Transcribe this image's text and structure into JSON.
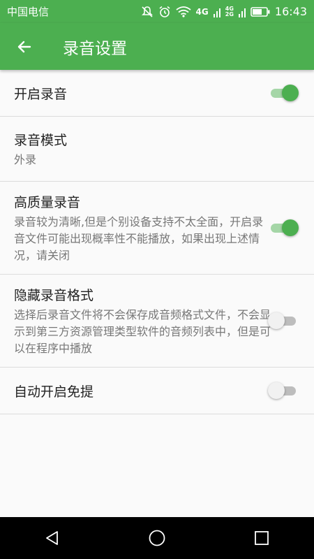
{
  "status_bar": {
    "carrier": "中国电信",
    "network_4g": "4G",
    "network_small_top": "4G",
    "network_small_bottom": "2G",
    "time": "16:43",
    "icons": [
      "mute-icon",
      "alarm-icon",
      "wifi-icon",
      "signal-icon",
      "battery-icon"
    ]
  },
  "app_bar": {
    "title": "录音设置",
    "back_icon": "arrow-left-icon",
    "color": "#4caf50"
  },
  "settings": [
    {
      "title": "开启录音",
      "subtitle": "",
      "toggle": true
    },
    {
      "title": "录音模式",
      "subtitle": "外录",
      "toggle": null
    },
    {
      "title": "高质量录音",
      "subtitle": "录音较为清晰,但是个别设备支持不太全面，开启录音文件可能出现概率性不能播放，如果出现上述情况，请关闭",
      "toggle": true
    },
    {
      "title": "隐藏录音格式",
      "subtitle": "选择后录音文件将不会保存成音频格式文件，不会显示到第三方资源管理类型软件的音频列表中，但是可以在程序中播放",
      "toggle": false
    },
    {
      "title": "自动开启免提",
      "subtitle": "",
      "toggle": false
    }
  ],
  "nav_bar": {
    "icons": [
      "back-triangle-icon",
      "home-circle-icon",
      "recents-square-icon"
    ]
  }
}
